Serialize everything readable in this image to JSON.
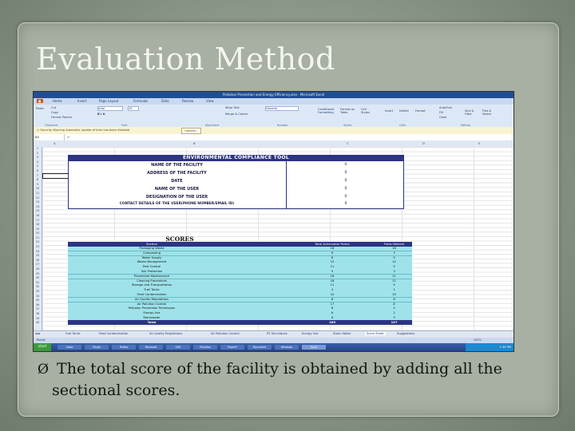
{
  "slide": {
    "title": "Evaluation Method",
    "bullet_symbol": "Ø",
    "bullet_line1": "The total score of the facility is obtained by adding all the",
    "bullet_line2": "sectional scores."
  },
  "excel": {
    "window_title": "Pollution Prevention and Energy Efficiency.xlsx - Microsoft Excel",
    "ribbon_tabs": [
      "Home",
      "Insert",
      "Page Layout",
      "Formulas",
      "Data",
      "Review",
      "View"
    ],
    "ribbon_groups": [
      "Clipboard",
      "Font",
      "Alignment",
      "Number",
      "Styles",
      "Cells",
      "Editing"
    ],
    "ribbon_buttons": {
      "cut": "Cut",
      "copy": "Copy",
      "format_painter": "Format Painter",
      "paste": "Paste",
      "font_name": "Arial",
      "font_size": "10",
      "wrap_text": "Wrap Text",
      "merge_center": "Merge & Center",
      "number_format": "General",
      "cond_format": "Conditional Formatting",
      "format_table": "Format as Table",
      "cell_styles": "Cell Styles",
      "insert": "Insert",
      "delete": "Delete",
      "format": "Format",
      "autosum": "AutoSum",
      "fill": "Fill",
      "clear": "Clear",
      "sort_filter": "Sort & Filter",
      "find_select": "Find & Select"
    },
    "security_warning": "Security Warning   Automatic update of links has been disabled",
    "options_button": "Options...",
    "name_box": "A5",
    "column_headers": [
      "A",
      "B",
      "C",
      "D",
      "E"
    ],
    "row_numbers": [
      "1",
      "2",
      "3",
      "4",
      "5",
      "6",
      "7",
      "8",
      "9",
      "10",
      "11",
      "12",
      "13",
      "14",
      "15",
      "16",
      "17",
      "18",
      "19",
      "20",
      "21",
      "22",
      "23",
      "24",
      "25",
      "26",
      "27",
      "28",
      "29",
      "30",
      "31",
      "32",
      "33",
      "34",
      "35",
      "36",
      "37",
      "38",
      "39",
      "40"
    ],
    "ect": {
      "header": "ENVIRONMENTAL COMPLIANCE TOOL",
      "rows": [
        {
          "label": "NAME OF THE FACILITY",
          "value": "0"
        },
        {
          "label": "ADDRESS OF THE FACILITY",
          "value": "0"
        },
        {
          "label": "DATE",
          "value": "0"
        },
        {
          "label": "NAME OF THE USER",
          "value": "0"
        },
        {
          "label": "DESIGNATION OF THE USER",
          "value": "0"
        },
        {
          "label": "CONTACT DETAILS OF THE USER(PHONE NUMBER/EMAIL ID)",
          "value": "0"
        }
      ]
    },
    "scores": {
      "title": "SCORES",
      "col_section": "Section",
      "col_total": "Total Achievable Points",
      "col_obtained": "Points Obtained",
      "rows": [
        {
          "section": "Packaging Waste",
          "total": "18",
          "obtained": "18"
        },
        {
          "section": "Composting",
          "total": "6",
          "obtained": "3"
        },
        {
          "section": "Water Supply",
          "total": "8",
          "obtained": "5"
        },
        {
          "section": "Waste Management",
          "total": "15",
          "obtained": "12"
        },
        {
          "section": "Pest Control",
          "total": "11",
          "obtained": "5"
        },
        {
          "section": "Soil Protection",
          "total": "5",
          "obtained": "3"
        },
        {
          "section": "Preventive Maintenance",
          "total": "16",
          "obtained": "11"
        },
        {
          "section": "Cleaning Procedures",
          "total": "16",
          "obtained": "11"
        },
        {
          "section": "Storage and Transportation",
          "total": "11",
          "obtained": "5"
        },
        {
          "section": "Fuel Tanks",
          "total": "4",
          "obtained": "1"
        },
        {
          "section": "Feed Contamination",
          "total": "10",
          "obtained": "10"
        },
        {
          "section": "Air Quality Regulations",
          "total": "8",
          "obtained": "6"
        },
        {
          "section": "Air Pollution Control",
          "total": "17",
          "obtained": "8"
        },
        {
          "section": "Pollution Prevention Techniques",
          "total": "8",
          "obtained": "4"
        },
        {
          "section": "Energy Use",
          "total": "6",
          "obtained": "2"
        },
        {
          "section": "Stormwater",
          "total": "6",
          "obtained": "3"
        }
      ],
      "total_label": "Total",
      "total_total": "165",
      "total_obtained": "107"
    },
    "sheet_tabs": [
      "Fuel Tanks",
      "Feed Contamination",
      "Air Quality Regulations",
      "Air Pollution Control",
      "P2 Techniques",
      "Energy Use",
      "Storm Water",
      "Score Sheet",
      "Suggestions"
    ],
    "status": "Ready",
    "zoom": "100%",
    "start_label": "start",
    "taskbar_items": [
      "Inbox",
      "Skype",
      "Firefox",
      "Microsoft",
      "EHS",
      "Pollution",
      "PowerP",
      "Document",
      "Windows",
      "Excel"
    ],
    "clock": "1:30 PM"
  }
}
